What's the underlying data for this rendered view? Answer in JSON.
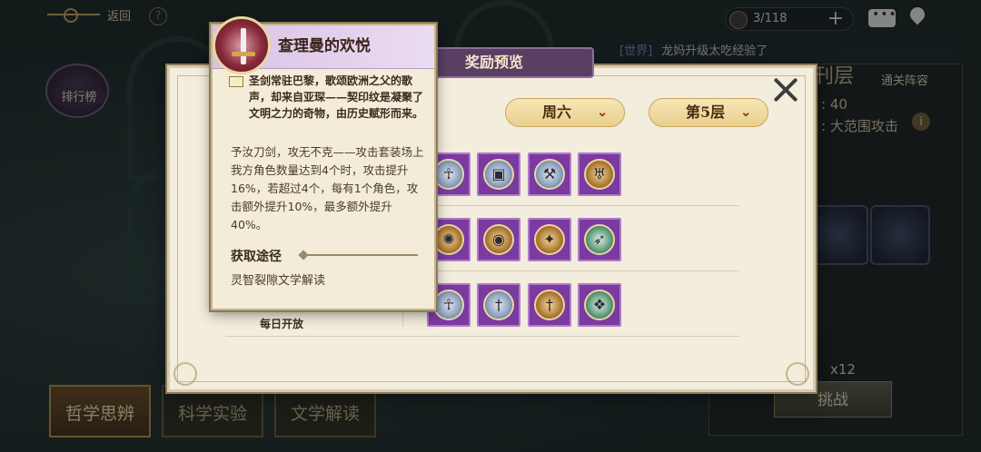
{
  "topbar": {
    "back_label": "返回",
    "help_glyph": "?",
    "resource_value": "3/118",
    "plus_glyph": "+"
  },
  "world_chat": {
    "channel": "[世界]",
    "message": "龙妈升级太吃经验了"
  },
  "left_side": {
    "rank_label": "排行榜",
    "tabs": [
      {
        "label": "哲学思辨",
        "active": true
      },
      {
        "label": "科学实验",
        "active": false
      },
      {
        "label": "文学解读",
        "active": false
      }
    ]
  },
  "right_panel": {
    "floor_title": "刊层",
    "team_label": "通关阵容",
    "value_1": ": 40",
    "value_2": ": 大范围攻击",
    "info_glyph": "i",
    "count": "x12",
    "challenge_label": "挑战"
  },
  "dialog": {
    "title": "奖励预览",
    "day_dropdown": "周六",
    "floor_dropdown": "第5层",
    "chevron": "⌄",
    "daily_label": "每日开放",
    "rows": [
      {
        "icons": [
          {
            "name": "scarab-relic-icon",
            "glyph": "☥",
            "style": "blue"
          },
          {
            "name": "chest-relic-icon",
            "glyph": "▣",
            "style": "blue"
          },
          {
            "name": "axe-relic-icon",
            "glyph": "⚒",
            "style": "blue"
          },
          {
            "name": "chalice-relic-icon",
            "glyph": "♅",
            "style": "gold"
          }
        ]
      },
      {
        "icons": [
          {
            "name": "beast-relic-icon",
            "glyph": "✺",
            "style": "gold"
          },
          {
            "name": "shield-relic-icon",
            "glyph": "◉",
            "style": "gold"
          },
          {
            "name": "scepter-relic-icon",
            "glyph": "✦",
            "style": "gold"
          },
          {
            "name": "spear-relic-icon",
            "glyph": "➶",
            "style": "teal"
          }
        ]
      },
      {
        "icons": [
          {
            "name": "ankh-relic-icon",
            "glyph": "☥",
            "style": "blue"
          },
          {
            "name": "sword-relic-icon",
            "glyph": "†",
            "style": "blue"
          },
          {
            "name": "dagger-relic-icon",
            "glyph": "†",
            "style": "gold"
          },
          {
            "name": "eagle-relic-icon",
            "glyph": "❖",
            "style": "teal"
          }
        ]
      }
    ]
  },
  "tooltip": {
    "title": "查理曼的欢悦",
    "flavor": "圣剑常驻巴黎，歌颂欧洲之父的歌声，却来自亚琛——契印纹是凝聚了文明之力的奇物，由历史赋形而来。",
    "effect": "予汝刀剑，攻无不克——攻击套装场上我方角色数量达到4个时，攻击提升16%，若超过4个，每有1个角色，攻击额外提升10%，最多额外提升40%。",
    "source_heading": "获取途径",
    "source": "灵智裂隙文学解读"
  },
  "colors": {
    "dialog_bg": "#f3eddd",
    "title_tab": "#5a3f62",
    "tile_purple": "#7a3aa0",
    "dropdown_gold": "#e8cf8c",
    "chevron_red": "#a0262a"
  }
}
